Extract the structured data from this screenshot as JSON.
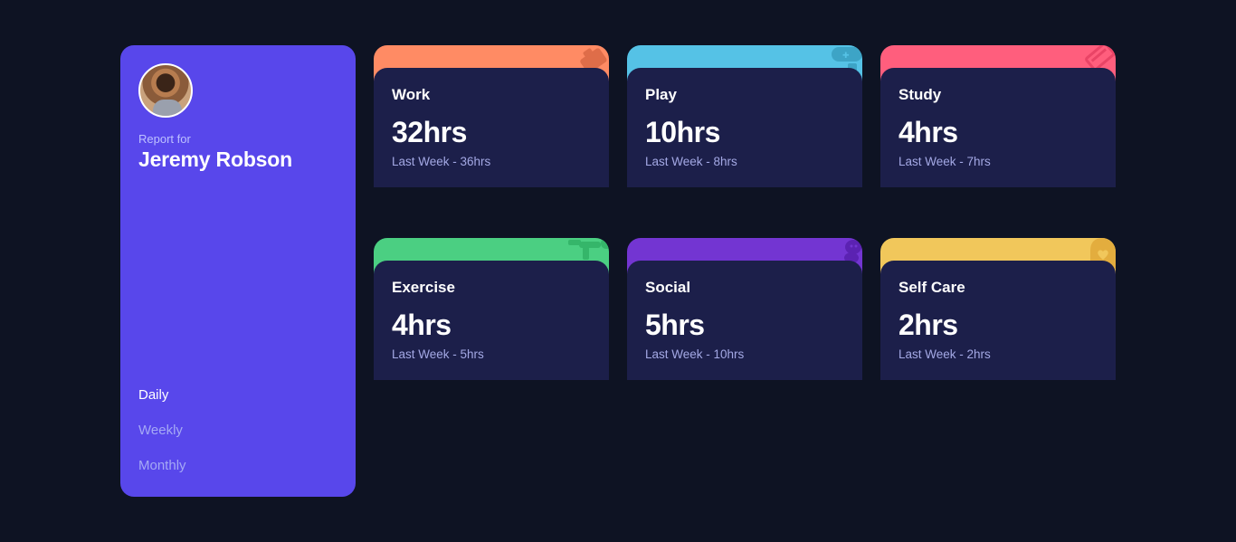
{
  "profile": {
    "report_for": "Report for",
    "name": "Jeremy Robson"
  },
  "periods": [
    "Daily",
    "Weekly",
    "Monthly"
  ],
  "active_period": "Daily",
  "activities": [
    {
      "title": "Work",
      "hours": "32hrs",
      "previous": "Last Week - 36hrs",
      "color": "#ff8b64",
      "icon": "briefcase-icon"
    },
    {
      "title": "Play",
      "hours": "10hrs",
      "previous": "Last Week - 8hrs",
      "color": "#55c2e6",
      "icon": "gamepad-icon"
    },
    {
      "title": "Study",
      "hours": "4hrs",
      "previous": "Last Week - 7hrs",
      "color": "#ff5e7d",
      "icon": "book-icon"
    },
    {
      "title": "Exercise",
      "hours": "4hrs",
      "previous": "Last Week - 5hrs",
      "color": "#4bcf82",
      "icon": "running-figure-icon"
    },
    {
      "title": "Social",
      "hours": "5hrs",
      "previous": "Last Week - 10hrs",
      "color": "#7335d2",
      "icon": "chat-bubble-icon"
    },
    {
      "title": "Self Care",
      "hours": "2hrs",
      "previous": "Last Week - 2hrs",
      "color": "#f1c75b",
      "icon": "heart-icon"
    }
  ]
}
